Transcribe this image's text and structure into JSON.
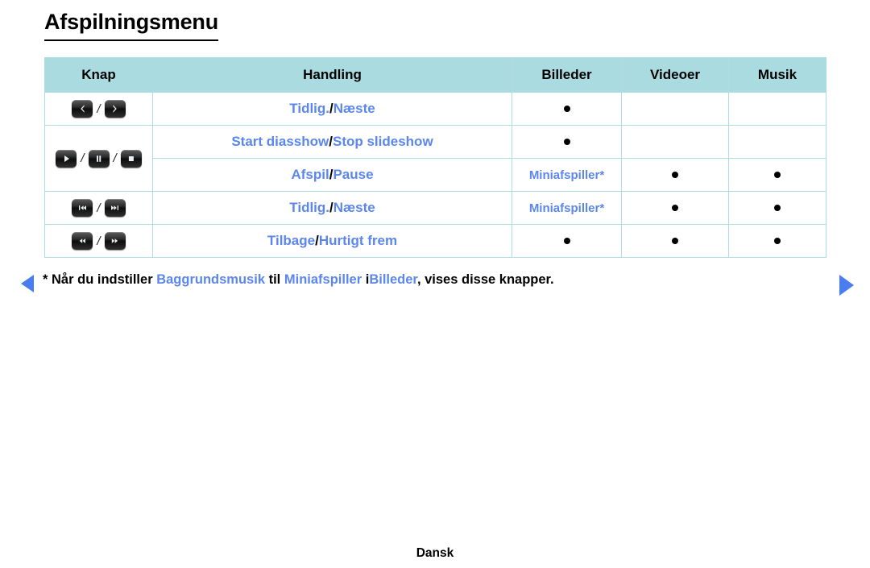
{
  "page": {
    "title": "Afspilningsmenu",
    "footer": "Dansk"
  },
  "table": {
    "headers": {
      "knap": "Knap",
      "handling": "Handling",
      "billeder": "Billeder",
      "videoer": "Videoer",
      "musik": "Musik"
    },
    "rows": [
      {
        "buttons": [
          "chevron-left",
          "chevron-right"
        ],
        "action_left": "Tidlig.",
        "action_sep": "/",
        "action_right": "Næste",
        "billeder": "dot",
        "videoer": "",
        "musik": ""
      },
      {
        "buttons": [
          "play",
          "pause",
          "stop"
        ],
        "action_left": "Start diasshow",
        "action_sep": "/",
        "action_right": "Stop slideshow",
        "billeder": "dot",
        "videoer": "",
        "musik": ""
      },
      {
        "buttons": [],
        "action_left": "Afspil",
        "action_sep": "/",
        "action_right": "Pause",
        "billeder": "Miniafspiller*",
        "videoer": "dot",
        "musik": "dot"
      },
      {
        "buttons": [
          "skip-previous",
          "skip-next"
        ],
        "action_left": "Tidlig.",
        "action_sep": "/",
        "action_right": "Næste",
        "billeder": "Miniafspiller*",
        "videoer": "dot",
        "musik": "dot"
      },
      {
        "buttons": [
          "rewind",
          "fast-forward"
        ],
        "action_left": "Tilbage",
        "action_sep": "/",
        "action_right": "Hurtigt frem",
        "billeder": "dot",
        "videoer": "dot",
        "musik": "dot"
      }
    ]
  },
  "footnote": {
    "asterisk": "*",
    "part1": "Når du indstiller",
    "hl1": "Baggrundsmusik",
    "part2": "til",
    "hl2": "Miniafspiller",
    "part3": "i",
    "hl3": "Billeder",
    "part4": ", vises disse knapper."
  },
  "colors": {
    "header_bg": "#a9dbe0",
    "border": "#addde2",
    "link_blue": "#5b86ef",
    "arrow_blue": "#4a7ef0"
  }
}
